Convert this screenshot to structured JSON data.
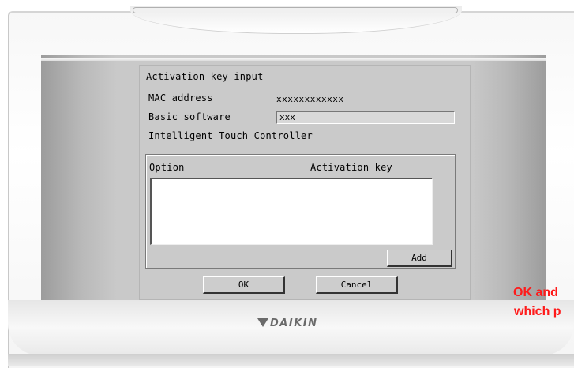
{
  "dialog": {
    "title": "Activation key input",
    "mac_label": "MAC address",
    "mac_value": "xxxxxxxxxxxx",
    "basic_software_label": "Basic software",
    "basic_software_value": "xxx",
    "product_name": "Intelligent Touch Controller"
  },
  "options_table": {
    "columns": [
      "Option",
      "Activation key"
    ],
    "rows": []
  },
  "buttons": {
    "add": "Add",
    "ok": "OK",
    "cancel": "Cancel"
  },
  "brand": "DAIKIN",
  "annotation": {
    "line1": "OK and",
    "line2": "which p"
  },
  "colors": {
    "annotation": "#ff1a1a",
    "screen_bg": "#cacaca",
    "brand": "#6b6b6b"
  },
  "icons": {
    "brand_logo": "daikin-logo-icon"
  }
}
